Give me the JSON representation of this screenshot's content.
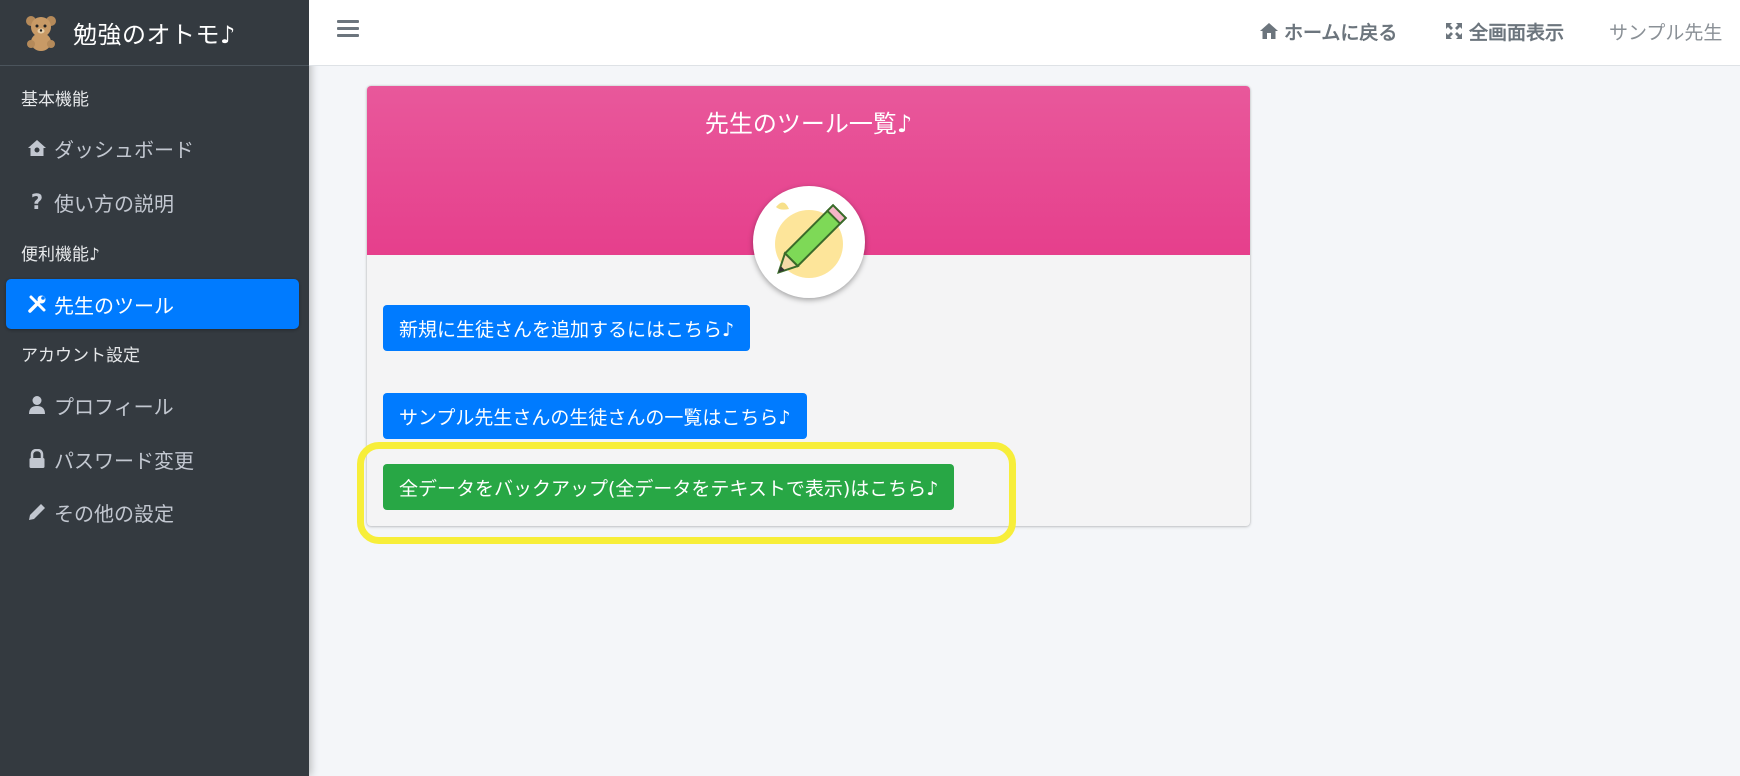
{
  "brand": {
    "title": "勉強のオトモ♪"
  },
  "sidebar": {
    "sections": [
      {
        "header": "基本機能",
        "items": [
          {
            "label": "ダッシュボード",
            "icon": "home-icon"
          },
          {
            "label": "使い方の説明",
            "icon": "question-icon"
          }
        ]
      },
      {
        "header": "便利機能♪",
        "items": [
          {
            "label": "先生のツール",
            "icon": "tools-icon",
            "active": true
          }
        ]
      },
      {
        "header": "アカウント設定",
        "items": [
          {
            "label": "プロフィール",
            "icon": "user-icon"
          },
          {
            "label": "パスワード変更",
            "icon": "lock-icon"
          },
          {
            "label": "その他の設定",
            "icon": "pencil-icon"
          }
        ]
      }
    ]
  },
  "topbar": {
    "home_label": "ホームに戻る",
    "fullscreen_label": "全画面表示",
    "user_name": "サンプル先生"
  },
  "card": {
    "title": "先生のツール一覧♪",
    "buttons": [
      {
        "label": "新規に生徒さんを追加するにはこちら♪",
        "color": "#007bff"
      },
      {
        "label": "サンプル先生さんの生徒さんの一覧はこちら♪",
        "color": "#007bff"
      },
      {
        "label": "全データをバックアップ(全データをテキストで表示)はこちら♪",
        "color": "#28a745"
      }
    ]
  },
  "colors": {
    "sidebar_bg": "#343a40",
    "active_blue": "#007bff",
    "header_pink": "#e63f8c",
    "success_green": "#28a745",
    "highlight_yellow": "#f7ee3a"
  }
}
